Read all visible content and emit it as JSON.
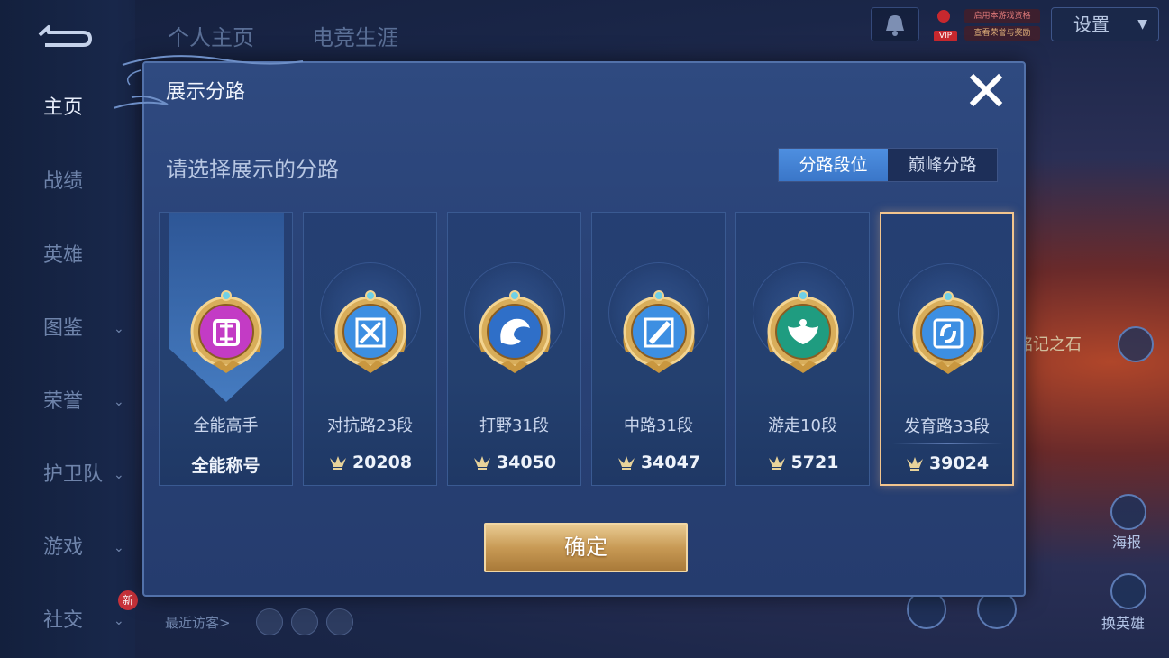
{
  "background": {
    "top_tabs": [
      "个人主页",
      "电竞生涯"
    ],
    "nav": [
      {
        "label": "主页",
        "chevron": false,
        "active": true
      },
      {
        "label": "战绩",
        "chevron": false,
        "active": false
      },
      {
        "label": "英雄",
        "chevron": false,
        "active": false
      },
      {
        "label": "图鉴",
        "chevron": true,
        "active": false
      },
      {
        "label": "荣誉",
        "chevron": true,
        "active": false
      },
      {
        "label": "护卫队",
        "chevron": true,
        "active": false
      },
      {
        "label": "游戏",
        "chevron": true,
        "active": false
      },
      {
        "label": "社交",
        "chevron": true,
        "active": false
      }
    ],
    "new_badge": "新",
    "settings_label": "设置",
    "vip_label": "VIP",
    "promo_lines": [
      "启用本游戏资格",
      "查看荣誉与奖励"
    ],
    "recent_visitors_label": "最近访客>",
    "stone_label": "铭记之石",
    "poster_label": "海报",
    "change_hero_label": "换英雄"
  },
  "modal": {
    "title": "展示分路",
    "prompt": "请选择展示的分路",
    "segments": [
      {
        "label": "分路段位",
        "active": true
      },
      {
        "label": "巅峰分路",
        "active": false
      }
    ],
    "cards": [
      {
        "name": "全能高手",
        "score": "全能称号",
        "score_icon": false,
        "emblem": "allround-icon",
        "color": "#c33bc5",
        "selected": false
      },
      {
        "name": "对抗路23段",
        "score": "20208",
        "score_icon": true,
        "emblem": "sword-icon",
        "color": "#3d8fe2",
        "selected": false
      },
      {
        "name": "打野31段",
        "score": "34050",
        "score_icon": true,
        "emblem": "dragon-icon",
        "color": "#2f6fc8",
        "selected": false
      },
      {
        "name": "中路31段",
        "score": "34047",
        "score_icon": true,
        "emblem": "staff-icon",
        "color": "#3d8fe2",
        "selected": false
      },
      {
        "name": "游走10段",
        "score": "5721",
        "score_icon": true,
        "emblem": "wings-icon",
        "color": "#1f9c80",
        "selected": false
      },
      {
        "name": "发育路33段",
        "score": "39024",
        "score_icon": true,
        "emblem": "bow-icon",
        "color": "#3d8fe2",
        "selected": true
      }
    ],
    "confirm_label": "确定",
    "colors": {
      "accent": "#3a76c8",
      "gold": "#c89a55",
      "selected_border": "#f2c58e"
    }
  }
}
